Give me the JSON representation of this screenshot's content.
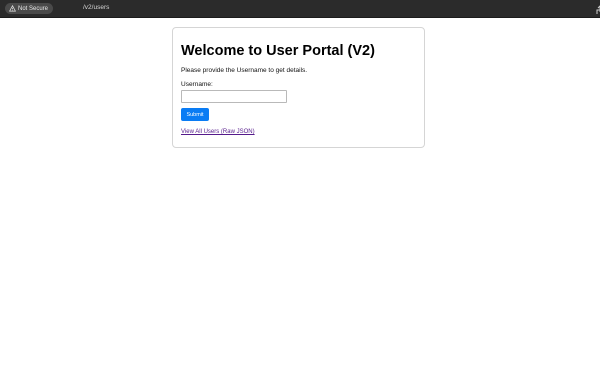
{
  "browser": {
    "security_label": "Not Secure",
    "url": "/v2/users",
    "security_icon": "warning-icon",
    "share_icon": "share-icon"
  },
  "form": {
    "title": "Welcome to User Portal (V2)",
    "description": "Please provide the Username to get details.",
    "username_label": "Username:",
    "username_value": "",
    "submit_label": "Submit",
    "raw_link_text": "View All Users (Raw JSON)"
  },
  "colors": {
    "browser_bar": "#2b2b2b",
    "button": "#0a7cf4",
    "visited_link": "#551a8b"
  }
}
